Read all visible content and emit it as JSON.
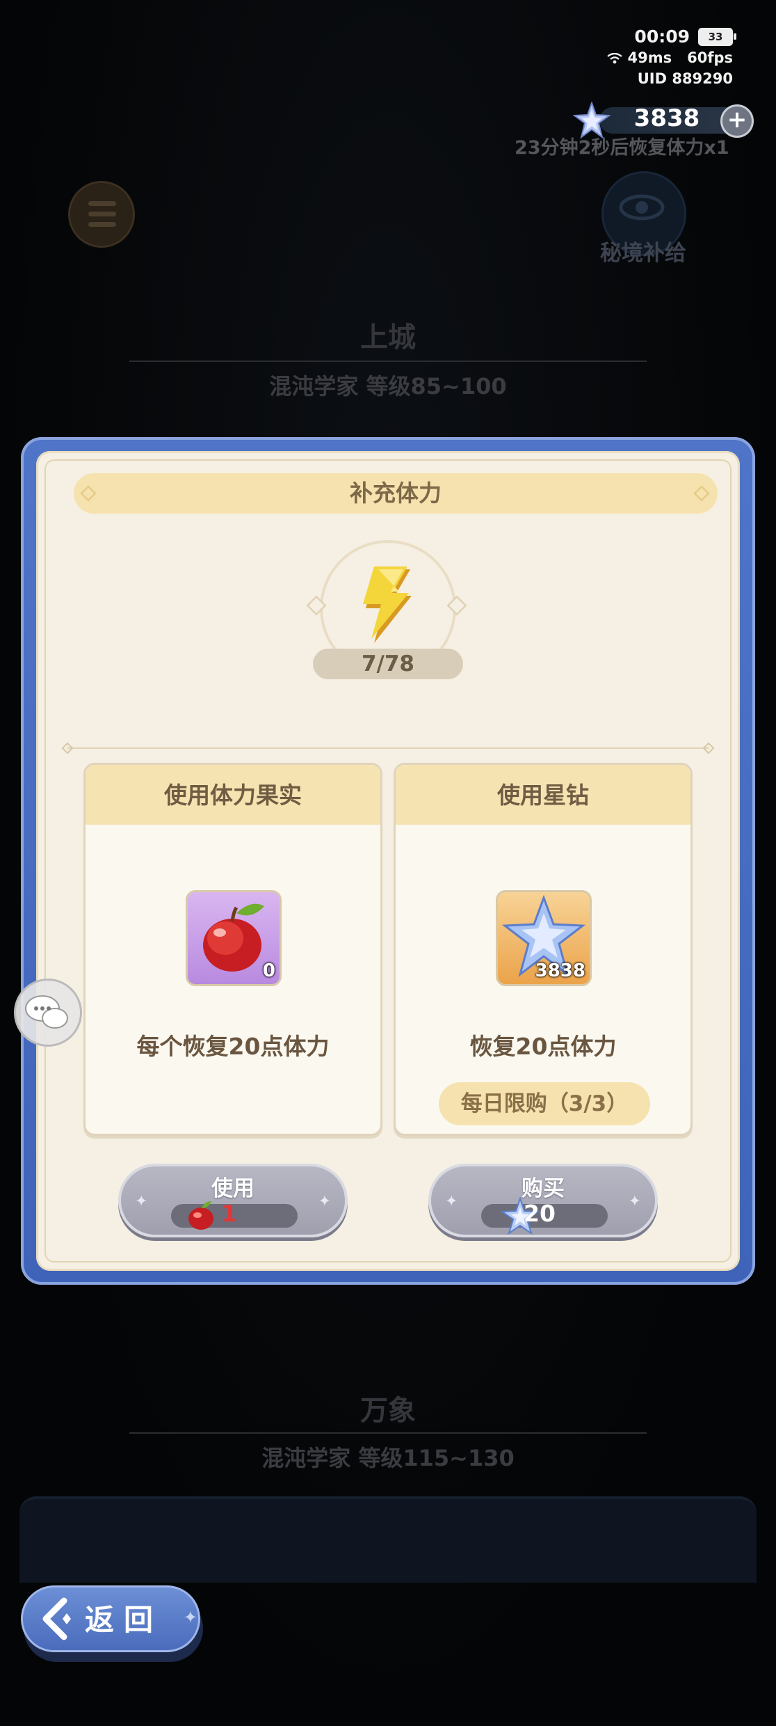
{
  "status_bar": {
    "time": "00:09",
    "battery": "33",
    "ping": "49ms",
    "fps": "60fps",
    "uid": "UID 889290"
  },
  "currency": {
    "amount": "3838",
    "regen_text": "23分钟2秒后恢复体力x1"
  },
  "top_actions": {
    "supply_label": "秘境补给"
  },
  "section_upper": {
    "title": "上城",
    "subtitle": "混沌学家  等级85~100"
  },
  "section_lower": {
    "title": "万象",
    "subtitle": "混沌学家  等级115~130"
  },
  "modal": {
    "title": "补充体力",
    "stamina": "7/78",
    "fruit_card": {
      "header": "使用体力果实",
      "count": "0",
      "desc": "每个恢复20点体力"
    },
    "gem_card": {
      "header": "使用星钻",
      "count": "3838",
      "desc": "恢复20点体力",
      "limit": "每日限购（3/3）"
    },
    "use_button": {
      "label": "使用",
      "cost": "1",
      "cost_color": "#e0383a"
    },
    "buy_button": {
      "label": "购买",
      "cost": "20",
      "cost_color": "#ffffff"
    }
  },
  "back_button": {
    "label": "返回"
  },
  "colors": {
    "modal_border": "#4f74c8",
    "panel_bg": "#f5f0e3",
    "banner": "#f6e2ae",
    "button_grey": "#a9a9b8"
  }
}
